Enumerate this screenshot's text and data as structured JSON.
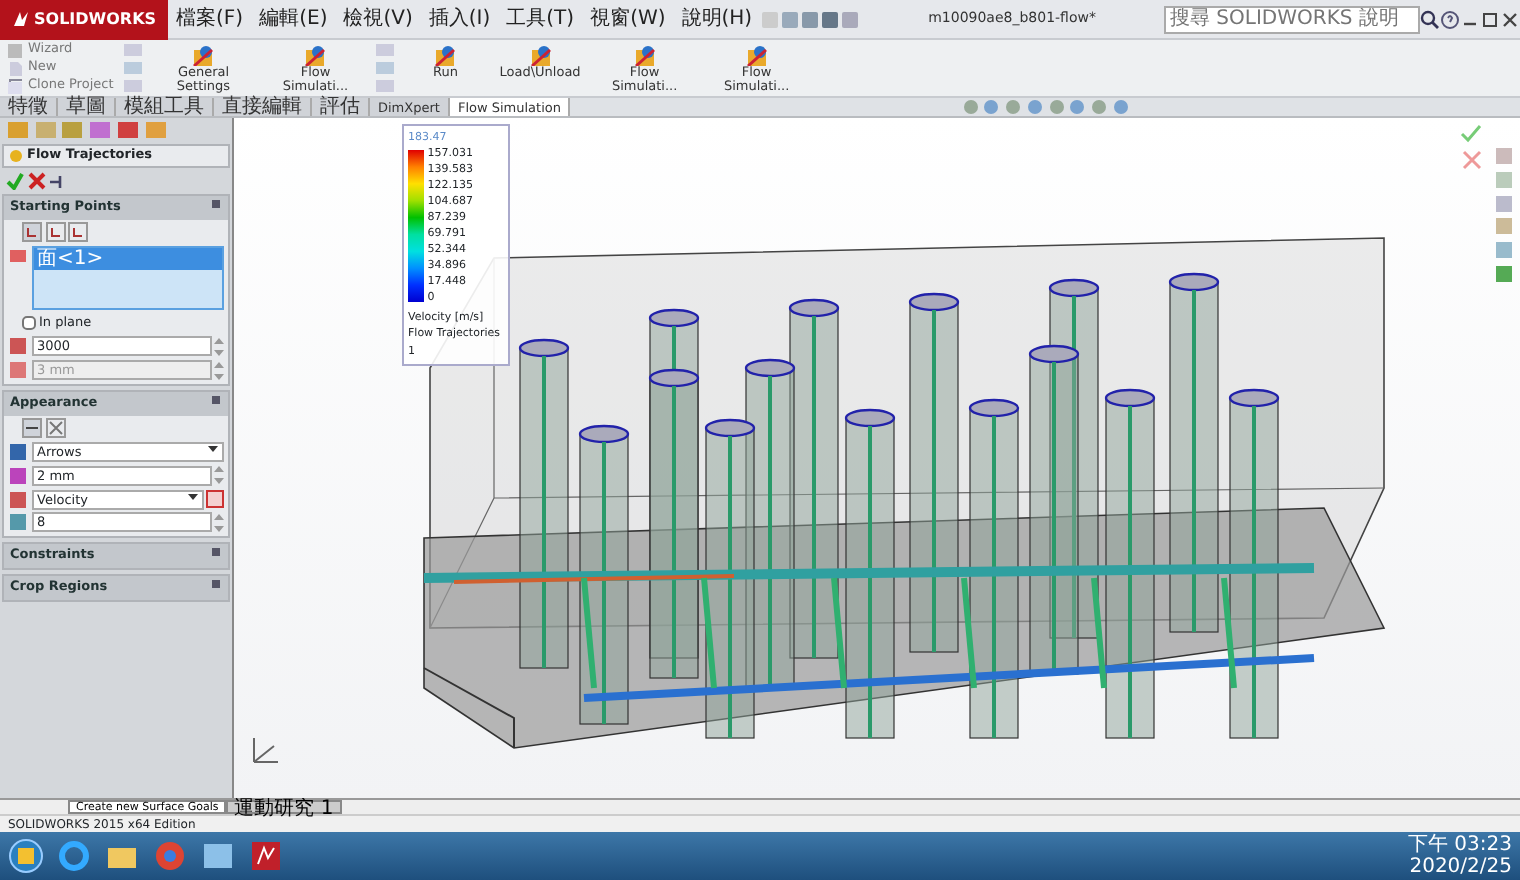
{
  "app": {
    "logo": "SOLIDWORKS",
    "menu": [
      "檔案(F)",
      "編輯(E)",
      "檢視(V)",
      "插入(I)",
      "工具(T)",
      "視窗(W)",
      "說明(H)"
    ],
    "title": "m10090ae8_b801-flow*",
    "search_placeholder": "搜尋 SOLIDWORKS 說明"
  },
  "toolbar": [
    {
      "label": "Wizard",
      "kind": "small"
    },
    {
      "label": "New",
      "kind": "small"
    },
    {
      "label": "Clone Project",
      "kind": "small"
    },
    {
      "label": "General Settings",
      "kind": "large"
    },
    {
      "label": "Flow Simulati...",
      "kind": "large"
    },
    {
      "label": "Run",
      "kind": "large"
    },
    {
      "label": "Load\\Unload",
      "kind": "large"
    },
    {
      "label": "Flow Simulati...",
      "kind": "large"
    },
    {
      "label": "Flow Simulati...",
      "kind": "large"
    }
  ],
  "command_tabs": [
    {
      "label": "特徵",
      "selected": false
    },
    {
      "label": "草圖",
      "selected": false
    },
    {
      "label": "模組工具",
      "selected": false
    },
    {
      "label": "直接編輯",
      "selected": false
    },
    {
      "label": "評估",
      "selected": false
    },
    {
      "label": "DimXpert",
      "selected": false
    },
    {
      "label": "Flow Simulation",
      "selected": true
    }
  ],
  "panel": {
    "title": "Flow Trajectories",
    "starting_points": {
      "title": "Starting Points",
      "items": [
        {
          "label": "面<1>",
          "selected": true
        }
      ],
      "in_plane": {
        "label": "In plane",
        "checked": false
      },
      "count": "3000",
      "offset": {
        "value": "3 mm",
        "disabled": true
      }
    },
    "appearance": {
      "title": "Appearance",
      "draw_as": "Arrows",
      "size": "2 mm",
      "color_by": "Velocity",
      "value": "8"
    },
    "collapsed_sections": [
      "Constraints",
      "Crop Regions"
    ]
  },
  "legend": {
    "header": "183.47",
    "values": [
      "157.031",
      "139.583",
      "122.135",
      "104.687",
      "87.239",
      "69.791",
      "52.344",
      "34.896",
      "17.448",
      "0"
    ],
    "quantity": "Velocity [m/s]",
    "plot_name": "Flow Trajectories 1"
  },
  "bottom_tabs": [
    {
      "label": "Create new Surface Goals",
      "selected": true
    },
    {
      "label": "運動研究 1",
      "selected": false
    }
  ],
  "status": "SOLIDWORKS 2015 x64 Edition",
  "clock": {
    "time": "下午 03:23",
    "date": "2020/2/25"
  }
}
